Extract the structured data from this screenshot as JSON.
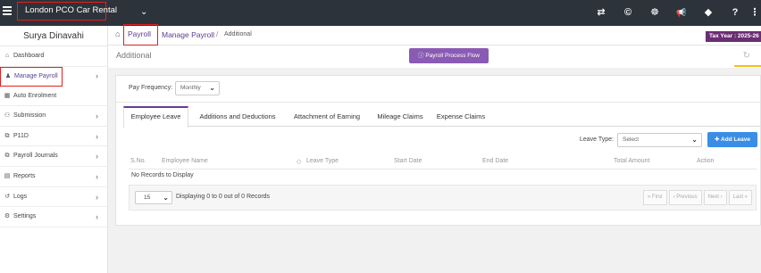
{
  "topbar": {
    "company": "London PCO Car Rental",
    "icons": [
      "transfer-icon",
      "copyright-icon",
      "users-cog-icon",
      "megaphone-icon",
      "tag-icon",
      "help-icon",
      "menu-dots-icon"
    ],
    "icon_glyphs": [
      "⇄",
      "©",
      "☸",
      "📢",
      "◆",
      "?",
      "⋮"
    ]
  },
  "sidebar": {
    "user_name": "Surya Dinavahi",
    "items": [
      {
        "label": "Dashboard",
        "icon": "⌂",
        "arrow": ""
      },
      {
        "label": "Manage Payroll",
        "icon": "♟",
        "arrow": "›"
      },
      {
        "label": "Auto Enrolment",
        "icon": "▦",
        "arrow": ""
      },
      {
        "label": "Submission",
        "icon": "⚇",
        "arrow": "›"
      },
      {
        "label": "P11D",
        "icon": "⧉",
        "arrow": "›"
      },
      {
        "label": "Payroll Journals",
        "icon": "⧉",
        "arrow": "›"
      },
      {
        "label": "Reports",
        "icon": "▤",
        "arrow": "›"
      },
      {
        "label": "Logs",
        "icon": "↺",
        "arrow": "›"
      },
      {
        "label": "Settings",
        "icon": "⚙",
        "arrow": "›"
      }
    ]
  },
  "breadcrumb": {
    "home_icon": "⌂",
    "payroll": "Payroll",
    "manage": "Manage Payroll",
    "separator": "/",
    "current": "Additional",
    "tax_year": "Tax Year : 2025-26"
  },
  "title": {
    "page_title": "Additional",
    "process_flow_label": "Payroll Process Flow",
    "refresh_icon": "↻"
  },
  "filters": {
    "pay_frequency_label": "Pay Frequency:",
    "pay_frequency_value": "Monthly"
  },
  "tabs": [
    "Employee Leave",
    "Additions and Deductions",
    "Attachment of Earning",
    "Mileage Claims",
    "Expense Claims"
  ],
  "leave": {
    "leave_type_label": "Leave Type:",
    "leave_type_value": "Select",
    "add_button": "✚ Add Leave"
  },
  "grid": {
    "columns": [
      "S.No.",
      "Employee Name",
      "Leave Type",
      "Start Date",
      "End Date",
      "Total Amount",
      "Action"
    ],
    "empty_text": "No Records to Display"
  },
  "pager": {
    "page_size": "15",
    "info": "Displaying 0 to 0 out of 0 Records",
    "first": "« First",
    "previous": "‹ Previous",
    "next": "Next ›",
    "last": "Last »"
  }
}
